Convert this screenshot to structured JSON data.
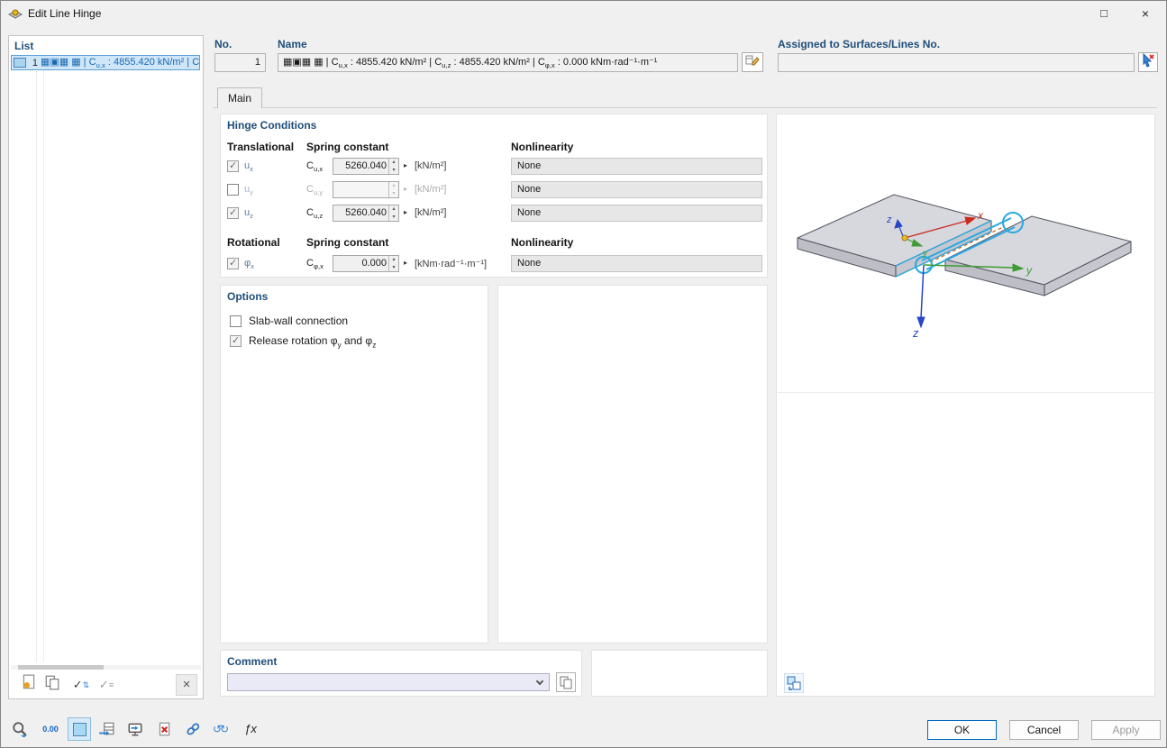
{
  "window": {
    "title": "Edit Line Hinge"
  },
  "window_controls": {
    "maximize": "□",
    "close": "×"
  },
  "list_panel": {
    "header": "List",
    "items": [
      {
        "number": "1",
        "text_html": "▦▣▦ ▦ | C<sub>u,x</sub> : 4855.420 kN/m² | C"
      }
    ]
  },
  "header_fields": {
    "no_label": "No.",
    "no_value": "1",
    "name_label": "Name",
    "name_value_html": "▦▣▦ ▦ | C<sub>u,x</sub> : 4855.420 kN/m² | C<sub>u,z</sub> : 4855.420 kN/m² | C<sub>φ,x</sub> : 0.000 kNm·rad⁻¹·m⁻¹",
    "assigned_label": "Assigned to Surfaces/Lines No.",
    "assigned_value": ""
  },
  "tabs": {
    "main": "Main"
  },
  "hinge_conditions": {
    "title": "Hinge Conditions",
    "translational_header": "Translational",
    "rotational_header": "Rotational",
    "spring_constant_header": "Spring constant",
    "nonlinearity_header": "Nonlinearity",
    "rows": [
      {
        "axis_html": "u<sub>x</sub>",
        "constant_html": "C<sub>u,x</sub>",
        "value": "5260.040",
        "unit_html": "[kN/m²]",
        "nonlinearity": "None",
        "checked": true,
        "enabled": true
      },
      {
        "axis_html": "u<sub>y</sub>",
        "constant_html": "C<sub>u,y</sub>",
        "value": "",
        "unit_html": "[kN/m²]",
        "nonlinearity": "None",
        "checked": false,
        "enabled": false
      },
      {
        "axis_html": "u<sub>z</sub>",
        "constant_html": "C<sub>u,z</sub>",
        "value": "5260.040",
        "unit_html": "[kN/m²]",
        "nonlinearity": "None",
        "checked": true,
        "enabled": true
      },
      {
        "axis_html": "φ<sub>x</sub>",
        "constant_html": "C<sub>φ,x</sub>",
        "value": "0.000",
        "unit_html": "[kNm·rad⁻¹·m⁻¹]",
        "nonlinearity": "None",
        "checked": true,
        "enabled": true
      }
    ]
  },
  "options": {
    "title": "Options",
    "items": [
      {
        "label_html": "Slab-wall connection",
        "checked": false
      },
      {
        "label_html": "Release rotation φ<sub>y</sub> and φ<sub>z</sub>",
        "checked": true
      }
    ]
  },
  "comment": {
    "title": "Comment",
    "value": ""
  },
  "graphic": {
    "axis_labels": {
      "x": "x",
      "y": "y",
      "z": "z"
    }
  },
  "footer": {
    "ok": "OK",
    "cancel": "Cancel",
    "apply": "Apply"
  },
  "icons": {
    "spin_up": "▴",
    "spin_down": "▾",
    "detail_arrow": "▸",
    "check": "✓",
    "arrows_updown": "⇅",
    "lines": "≡",
    "delete_x": "×",
    "decimals": "0.00",
    "refresh": "↺↻",
    "formula": "ƒx"
  },
  "colors": {
    "accent_blue": "#0067c0",
    "selection_blue": "#cfe6f9",
    "hinge_cyan": "#29a8e0",
    "header_navy": "#1f4e79"
  }
}
